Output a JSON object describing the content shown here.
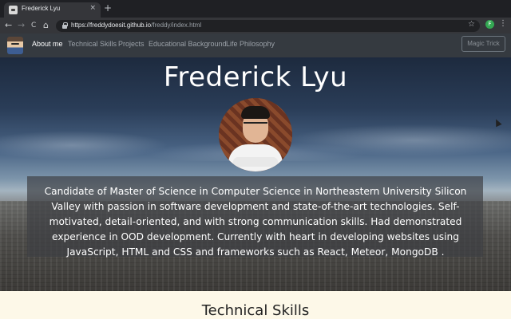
{
  "browser": {
    "tab_title": "Frederick Lyu",
    "tab_close": "×",
    "new_tab": "+",
    "url_host": "https://freddydoesit.github.io",
    "url_path": "/freddy/index.html",
    "back": "←",
    "forward": "→",
    "reload": "C",
    "home": "⌂",
    "star": "☆",
    "extension_badge": "F",
    "menu": "⋮"
  },
  "navbar": {
    "items": [
      {
        "label": "About me",
        "active": true
      },
      {
        "label": "Technical Skills",
        "active": false
      },
      {
        "label": "Projects",
        "active": false
      },
      {
        "label": "Educational Background",
        "active": false
      },
      {
        "label": "Life Philosophy",
        "active": false
      }
    ],
    "magic_button": "Magic Trick"
  },
  "hero": {
    "name": "Frederick Lyu",
    "bio": "Candidate of Master of Science in Computer Science in Northeastern University Silicon Valley with passion in software development and state-of-the-art technologies. Self-motivated, detail-oriented, and with strong communication skills. Had demonstrated experience in OOD development. Currently with heart in developing websites using JavaScript, HTML and CSS and frameworks such as React, Meteor, MongoDB ."
  },
  "next_section": {
    "title": "Technical Skills"
  },
  "colors": {
    "navbar_bg": "#353a40",
    "section_bg": "#fdf8e8",
    "tab_bg": "#35363a"
  }
}
